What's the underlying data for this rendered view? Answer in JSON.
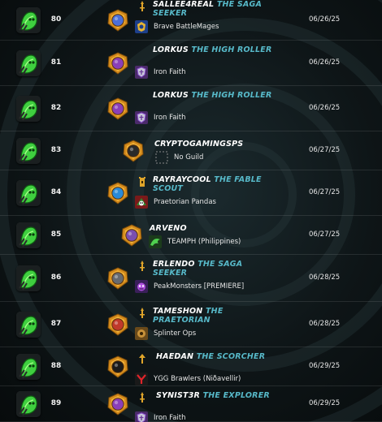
{
  "colors": {
    "title_accent": "#57b9c9",
    "player_name": "#ffffff",
    "background": "#0e1517"
  },
  "rows": [
    {
      "number": "80",
      "player": "SALLEE4REAL",
      "title": "THE SAGA SEEKER",
      "guild": "Brave BattleMages",
      "guild_icon": "emblem-blue-gold",
      "date": "06/26/25",
      "rank_color": "#4b6fd8",
      "rank_icon": "gold-spear-icon"
    },
    {
      "number": "81",
      "player": "LORKUS",
      "title": "THE HIGH ROLLER",
      "guild": "Iron Faith",
      "guild_icon": "shield-purple",
      "date": "06/26/25",
      "rank_color": "#8a3fb8",
      "rank_icon": "none"
    },
    {
      "number": "82",
      "player": "LORKUS",
      "title": "THE HIGH ROLLER",
      "guild": "Iron Faith",
      "guild_icon": "shield-purple",
      "date": "06/26/25",
      "rank_color": "#8a3fb8",
      "rank_icon": "none"
    },
    {
      "number": "83",
      "player": "CRYPTOGAMINGSPS",
      "title": "",
      "guild": "No Guild",
      "guild_icon": "empty-dashed-box",
      "date": "06/27/25",
      "rank_color": "#2a2a2a",
      "rank_icon": "none"
    },
    {
      "number": "84",
      "player": "RAYRAYCOOL",
      "title": "THE FABLE SCOUT",
      "guild": "Praetorian Pandas",
      "guild_icon": "panda-red-green",
      "date": "06/27/25",
      "rank_color": "#2a8ad8",
      "rank_icon": "tower-icon"
    },
    {
      "number": "85",
      "player": "ARVENO",
      "title": "",
      "guild": "TEAMPH (Philippines)",
      "guild_icon": "dragon-green",
      "date": "06/27/25",
      "rank_color": "#7a4fb0",
      "rank_icon": "none"
    },
    {
      "number": "86",
      "player": "ERLENDO",
      "title": "THE SAGA SEEKER",
      "guild": "PeakMonsters [PREMIERE]",
      "guild_icon": "monster-purple",
      "date": "06/28/25",
      "rank_color": "#666a70",
      "rank_icon": "gold-spear-icon"
    },
    {
      "number": "87",
      "player": "TAMESHON",
      "title": "THE PRAETORIAN",
      "guild": "Splinter Ops",
      "guild_icon": "ops-brown",
      "date": "06/28/25",
      "rank_color": "#c0392b",
      "rank_icon": "gold-spear-icon"
    },
    {
      "number": "88",
      "player": "HAEDAN",
      "title": "THE SCORCHER",
      "guild": "YGG Brawlers (Niðavellir)",
      "guild_icon": "ygg-red",
      "date": "06/29/25",
      "rank_color": "#1a1a1a",
      "rank_icon": "gold-arrow-icon"
    },
    {
      "number": "89",
      "player": "SYNIST3R",
      "title": "THE EXPLORER",
      "guild": "Iron Faith",
      "guild_icon": "shield-purple",
      "date": "06/29/25",
      "rank_color": "#8a3fb8",
      "rank_icon": "gold-spear-icon"
    }
  ]
}
